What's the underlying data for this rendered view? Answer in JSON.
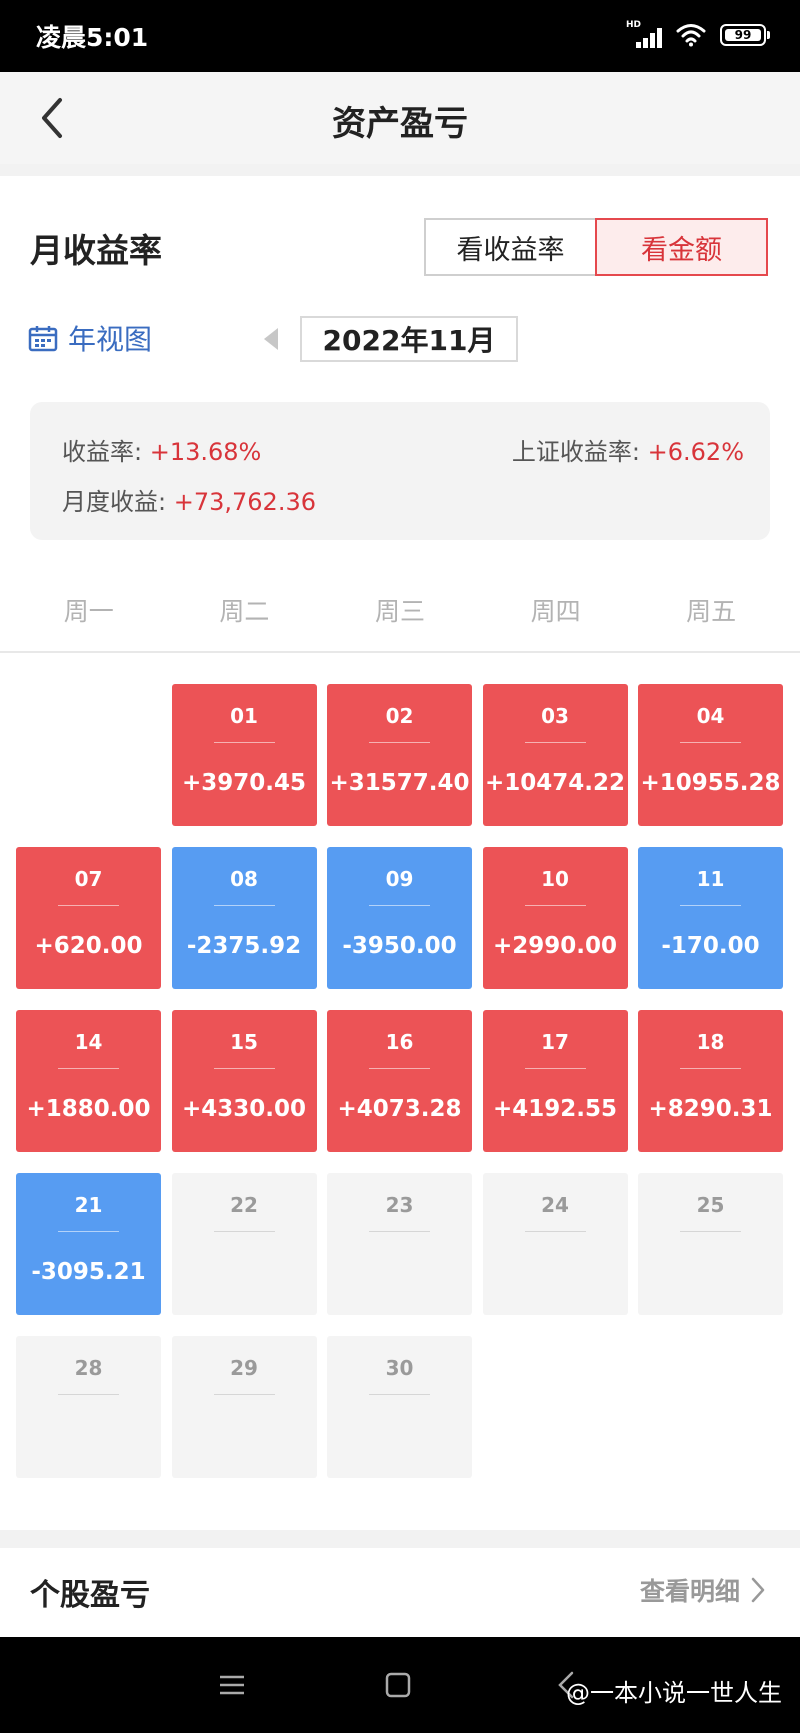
{
  "status_bar": {
    "time": "凌晨5:01",
    "network": "HD",
    "battery": "99",
    "icons": [
      "signal-icon",
      "wifi-icon",
      "battery-icon"
    ]
  },
  "nav": {
    "title": "资产盈亏",
    "back_icon": "chevron-left-icon"
  },
  "section": {
    "title": "月收益率",
    "toggle": [
      {
        "label": "看收益率",
        "active": false
      },
      {
        "label": "看金额",
        "active": true
      }
    ]
  },
  "date_bar": {
    "year_view_label": "年视图",
    "year_view_icon": "calendar-icon",
    "month": "2022年11月"
  },
  "summary": {
    "return_label": "收益率:",
    "return_value": "+13.68%",
    "index_label": "上证收益率:",
    "index_value": "+6.62%",
    "monthly_label": "月度收益:",
    "monthly_value": "+73,762.36"
  },
  "weekdays": [
    "周一",
    "周二",
    "周三",
    "周四",
    "周五"
  ],
  "colors": {
    "gain": "#ec5356",
    "loss": "#579cf2",
    "empty": "#f4f4f4",
    "accent": "#d8343a",
    "link": "#3a6cc0"
  },
  "calendar": [
    {
      "day": "01",
      "amount": "+3970.45",
      "status": "gain"
    },
    {
      "day": "02",
      "amount": "+31577.40",
      "status": "gain"
    },
    {
      "day": "03",
      "amount": "+10474.22",
      "status": "gain"
    },
    {
      "day": "04",
      "amount": "+10955.28",
      "status": "gain"
    },
    {
      "day": "07",
      "amount": "+620.00",
      "status": "gain"
    },
    {
      "day": "08",
      "amount": "-2375.92",
      "status": "loss"
    },
    {
      "day": "09",
      "amount": "-3950.00",
      "status": "loss"
    },
    {
      "day": "10",
      "amount": "+2990.00",
      "status": "gain"
    },
    {
      "day": "11",
      "amount": "-170.00",
      "status": "loss"
    },
    {
      "day": "14",
      "amount": "+1880.00",
      "status": "gain"
    },
    {
      "day": "15",
      "amount": "+4330.00",
      "status": "gain"
    },
    {
      "day": "16",
      "amount": "+4073.28",
      "status": "gain"
    },
    {
      "day": "17",
      "amount": "+4192.55",
      "status": "gain"
    },
    {
      "day": "18",
      "amount": "+8290.31",
      "status": "gain"
    },
    {
      "day": "21",
      "amount": "-3095.21",
      "status": "loss"
    },
    {
      "day": "22",
      "amount": "",
      "status": "empty"
    },
    {
      "day": "23",
      "amount": "",
      "status": "empty"
    },
    {
      "day": "24",
      "amount": "",
      "status": "empty"
    },
    {
      "day": "25",
      "amount": "",
      "status": "empty"
    },
    {
      "day": "28",
      "amount": "",
      "status": "empty"
    },
    {
      "day": "29",
      "amount": "",
      "status": "empty"
    },
    {
      "day": "30",
      "amount": "",
      "status": "empty"
    }
  ],
  "stock_section": {
    "title": "个股盈亏",
    "detail_link": "查看明细",
    "detail_icon": "chevron-right-icon"
  },
  "system_nav": {
    "icons": [
      "menu-icon",
      "home-square-icon",
      "back-icon"
    ],
    "watermark": "@一本小说一世人生"
  }
}
